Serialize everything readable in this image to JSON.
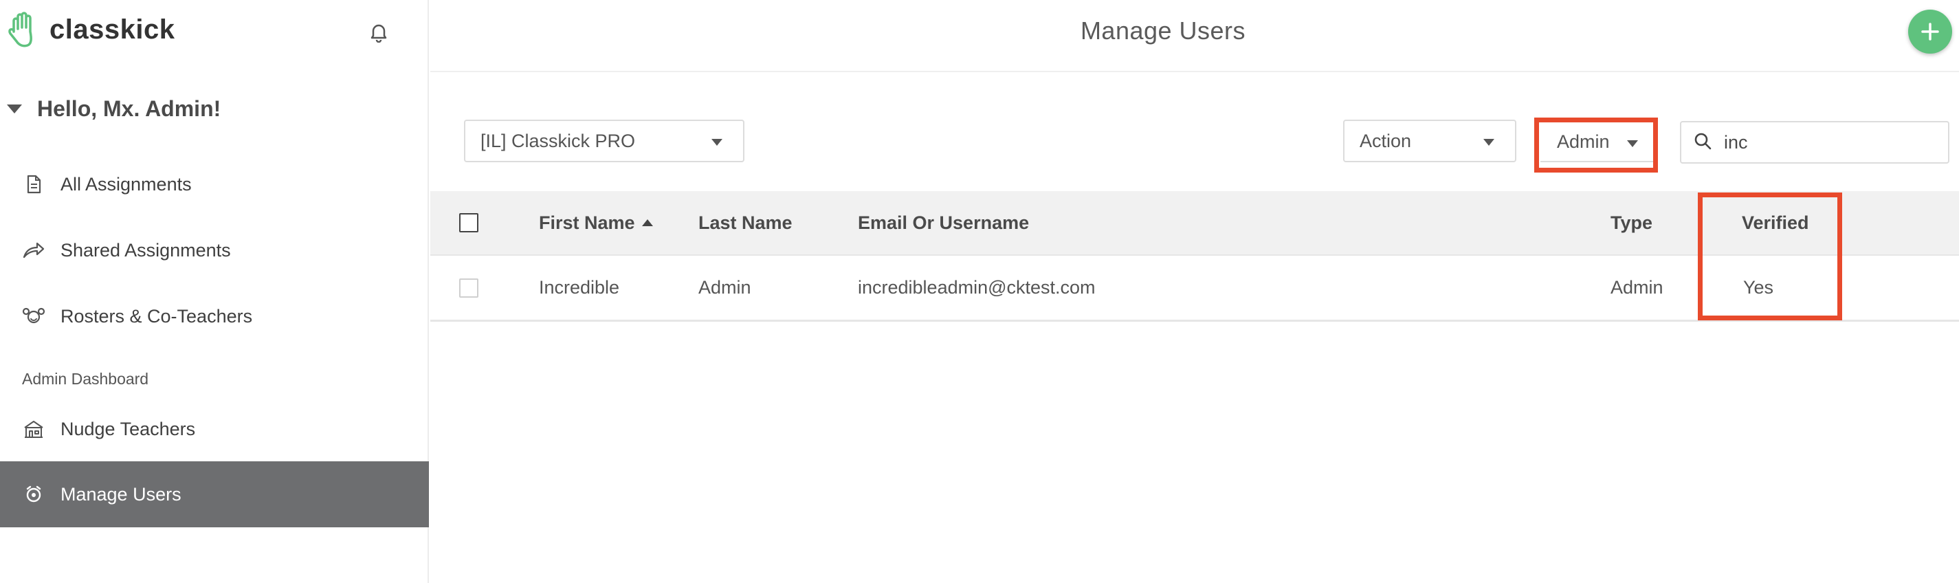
{
  "app": {
    "logo_text": "classkick"
  },
  "sidebar": {
    "greeting": "Hello, Mx. Admin!",
    "items": [
      {
        "label": "All Assignments",
        "icon": "document-icon"
      },
      {
        "label": "Shared Assignments",
        "icon": "share-arrow-icon"
      },
      {
        "label": "Rosters & Co-Teachers",
        "icon": "roster-icon"
      }
    ],
    "section_label": "Admin Dashboard",
    "admin_items": [
      {
        "label": "Nudge Teachers",
        "icon": "school-building-icon"
      },
      {
        "label": "Manage Users",
        "icon": "manage-users-icon",
        "active": true
      }
    ]
  },
  "header": {
    "title": "Manage Users"
  },
  "filters": {
    "organization": "[IL] Classkick PRO",
    "action": "Action",
    "role": "Admin",
    "search_value": "inc"
  },
  "table": {
    "columns": [
      "First Name",
      "Last Name",
      "Email Or Username",
      "Type",
      "Verified"
    ],
    "sort": {
      "column": "First Name",
      "direction": "ascending"
    },
    "rows": [
      {
        "first_name": "Incredible",
        "last_name": "Admin",
        "email": "incredibleadmin@cktest.com",
        "type": "Admin",
        "verified": "Yes"
      }
    ]
  },
  "colors": {
    "accent_green": "#5fc27e",
    "active_nav": "#6d6e70",
    "highlight": "#e84a2c"
  }
}
